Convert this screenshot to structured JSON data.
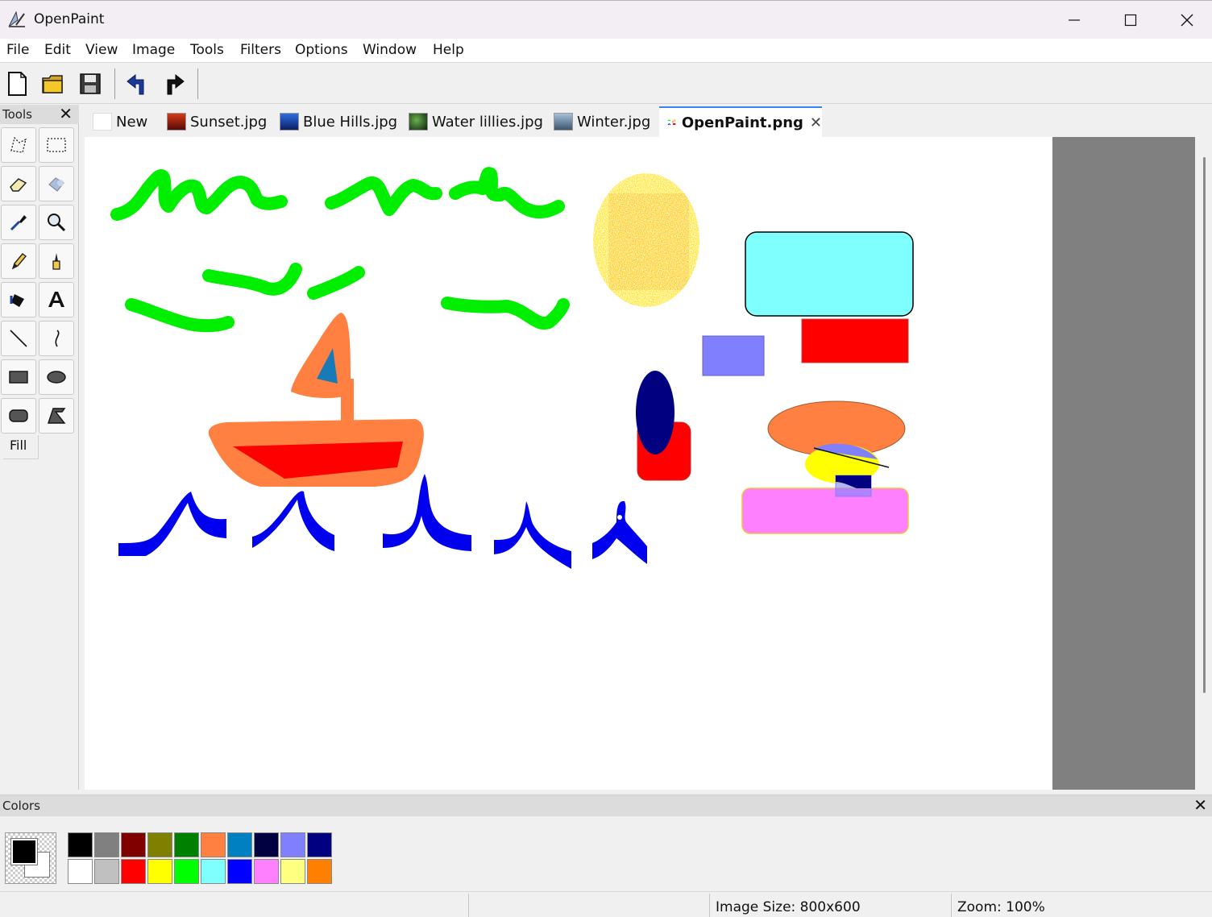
{
  "window": {
    "title": "OpenPaint"
  },
  "menu": [
    "File",
    "Edit",
    "View",
    "Image",
    "Tools",
    "Filters",
    "Options",
    "Window",
    "Help"
  ],
  "toolbar": {
    "buttons": [
      {
        "name": "new-file-icon"
      },
      {
        "name": "open-folder-icon"
      },
      {
        "name": "save-icon"
      },
      {
        "name": "undo-icon"
      },
      {
        "name": "redo-icon"
      }
    ]
  },
  "tools_panel": {
    "title": "Tools",
    "tools": [
      "free-select-icon",
      "rect-select-icon",
      "eraser-icon",
      "recolor-icon",
      "eyedropper-icon",
      "zoom-icon",
      "pencil-icon",
      "brush-icon",
      "paint-bucket-icon",
      "text-icon",
      "line-icon",
      "curve-icon",
      "rectangle-icon",
      "ellipse-icon",
      "rounded-rectangle-icon",
      "polygon-icon"
    ],
    "fill_label": "Fill"
  },
  "tabs": [
    {
      "label": "New",
      "thumb": "#ffffff"
    },
    {
      "label": "Sunset.jpg",
      "thumb": "#b31b1b"
    },
    {
      "label": "Blue Hills.jpg",
      "thumb": "#1d4fb8"
    },
    {
      "label": "Water lillies.jpg",
      "thumb": "#22411f"
    },
    {
      "label": "Winter.jpg",
      "thumb": "#4b6b8a"
    },
    {
      "label": "OpenPaint.png",
      "thumb": "#ffffff",
      "active": true
    }
  ],
  "colors_panel": {
    "title": "Colors",
    "primary": "#000000",
    "secondary": "#ffffff",
    "palette_top": [
      "#000000",
      "#808080",
      "#800000",
      "#808000",
      "#008000",
      "#ff8040",
      "#0080c0",
      "#000040",
      "#8080ff",
      "#000080"
    ],
    "palette_bottom": [
      "#ffffff",
      "#c0c0c0",
      "#ff0000",
      "#ffff00",
      "#00ff00",
      "#80ffff",
      "#0000ff",
      "#ff80ff",
      "#ffff80",
      "#ff8000"
    ]
  },
  "status": {
    "image_size": "Image Size: 800x600",
    "zoom": "Zoom: 100%"
  }
}
